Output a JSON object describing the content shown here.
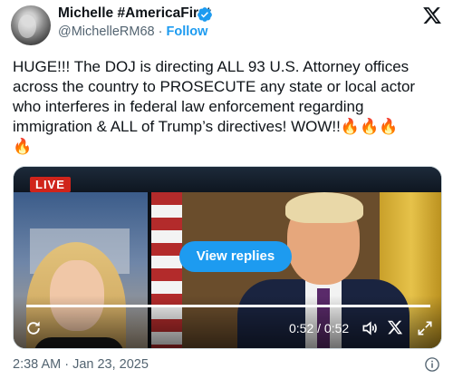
{
  "author": {
    "display_name": "Michelle #AmericaFirst",
    "handle": "@MichelleRM68",
    "separator": "·",
    "follow_label": "Follow",
    "verified_icon": "verified-badge-icon",
    "avatar_icon": "avatar"
  },
  "platform_icon": "x-logo-icon",
  "tweet": {
    "text": "HUGE!!! The DOJ is directing ALL 93 U.S. Attorney offices across the country to PROSECUTE any state or local actor who interferes in federal law enforcement regarding immigration & ALL of Trump’s directives! WOW!!",
    "emoji": [
      "🔥",
      "🔥",
      "🔥",
      "🔥"
    ]
  },
  "media": {
    "live_label": "LIVE",
    "view_replies_label": "View replies",
    "time_label": "0:52 / 0:52",
    "progress": 1.0,
    "controls": [
      "replay-icon",
      "volume-icon",
      "x-icon",
      "expand-icon"
    ]
  },
  "footer": {
    "timestamp": "2:38 AM · Jan 23, 2025",
    "info_icon": "info-icon"
  },
  "colors": {
    "accent": "#1d9bf0",
    "text": "#0f1419",
    "muted": "#536471",
    "live_red": "#d0241b"
  }
}
